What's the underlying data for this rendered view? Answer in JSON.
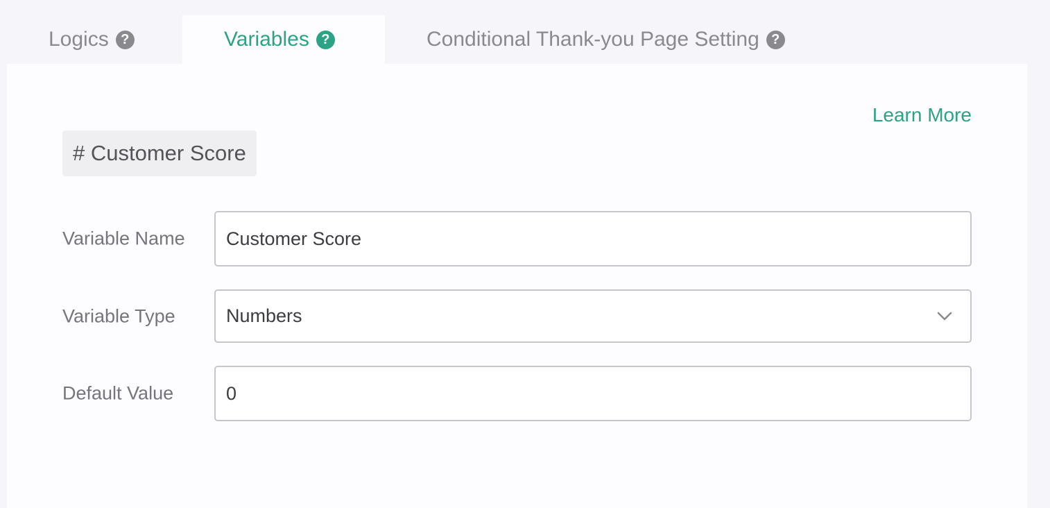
{
  "tabs": [
    {
      "label": "Logics",
      "active": false
    },
    {
      "label": "Variables",
      "active": true
    },
    {
      "label": "Conditional Thank-you Page Setting",
      "active": false
    }
  ],
  "panel": {
    "learn_more": "Learn More",
    "variable_chip": "# Customer Score",
    "fields": {
      "name": {
        "label": "Variable Name",
        "value": "Customer Score"
      },
      "type": {
        "label": "Variable Type",
        "value": "Numbers"
      },
      "default": {
        "label": "Default Value",
        "value": "0"
      }
    }
  },
  "icons": {
    "help": "question-circle-icon",
    "dropdown": "chevron-down-icon"
  },
  "colors": {
    "accent": "#2ea285",
    "inactive_tab": "#8a898e",
    "page_background": "#f6f5f9",
    "panel_background": "#fdfcfe",
    "chip_background": "#efeef1",
    "input_border": "#c7c6cb"
  }
}
